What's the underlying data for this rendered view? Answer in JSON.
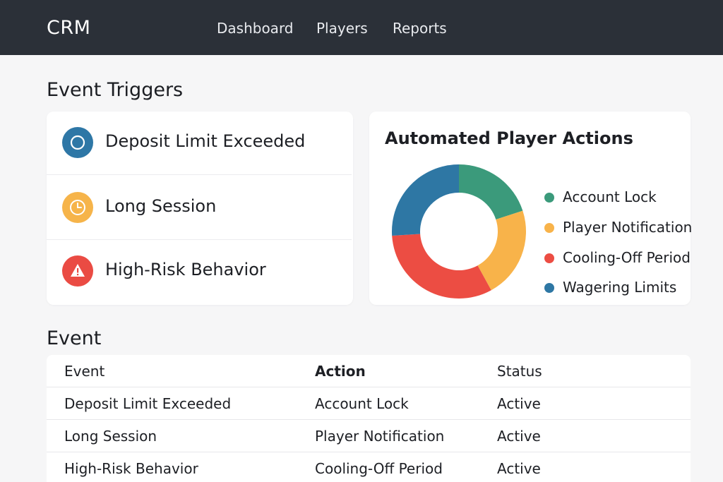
{
  "header": {
    "brand": "CRM",
    "nav": [
      "Dashboard",
      "Players",
      "Reports"
    ]
  },
  "triggers": {
    "title": "Event Triggers",
    "items": [
      {
        "label": "Deposit Limit Exceeded",
        "icon": "circle-icon",
        "color": "#2e77a6"
      },
      {
        "label": "Long Session",
        "icon": "clock-icon",
        "color": "#f6b44a"
      },
      {
        "label": "High-Risk Behavior",
        "icon": "warning-icon",
        "color": "#ea4b43"
      }
    ]
  },
  "actions_chart": {
    "title": "Automated Player Actions"
  },
  "chart_data": {
    "type": "pie",
    "donut": true,
    "title": "Automated Player Actions",
    "categories": [
      "Account Lock",
      "Player Notification",
      "Cooling-Off Period",
      "Wagering Limits"
    ],
    "values": [
      20,
      22,
      32,
      26
    ],
    "colors": {
      "Account Lock": "#3b9a7b",
      "Player Notification": "#f8b34a",
      "Cooling-Off Period": "#ec4d43",
      "Wagering Limits": "#2e77a4"
    },
    "legend": "right"
  },
  "event_table": {
    "title": "Event",
    "columns": [
      "Event",
      "Action",
      "Status"
    ],
    "rows": [
      [
        "Deposit Limit Exceeded",
        "Account Lock",
        "Active"
      ],
      [
        "Long Session",
        "Player Notification",
        "Active"
      ],
      [
        "High-Risk Behavior",
        "Cooling-Off Period",
        "Active"
      ]
    ]
  }
}
